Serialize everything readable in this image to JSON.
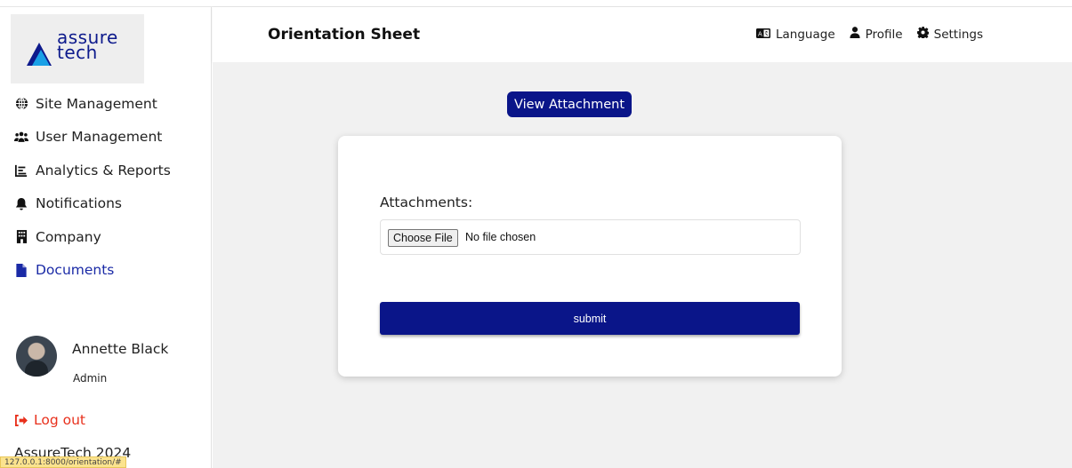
{
  "brand": {
    "line1": "assure",
    "line2": "tech"
  },
  "sidebar": {
    "items": [
      {
        "label": "Site Management",
        "icon": "globe-icon"
      },
      {
        "label": "User Management",
        "icon": "users-icon"
      },
      {
        "label": "Analytics & Reports",
        "icon": "chart-icon"
      },
      {
        "label": "Notifications",
        "icon": "bell-icon"
      },
      {
        "label": "Company",
        "icon": "building-icon"
      },
      {
        "label": "Documents",
        "icon": "document-icon",
        "active": true
      }
    ],
    "user": {
      "name": "Annette Black",
      "role": "Admin"
    },
    "logout_label": "Log out",
    "copyright": "AssureTech 2024"
  },
  "status_bar": {
    "url": "127.0.0.1:8000/orientation/#"
  },
  "header": {
    "title": "Orientation Sheet",
    "actions": [
      {
        "label": "Language",
        "icon": "language-icon"
      },
      {
        "label": "Profile",
        "icon": "user-icon"
      },
      {
        "label": "Settings",
        "icon": "gear-icon"
      }
    ]
  },
  "main": {
    "view_attachment_label": "View Attachment",
    "form": {
      "attachments_label": "Attachments:",
      "choose_file_label": "Choose File",
      "no_file_text": "No file chosen",
      "submit_label": "submit"
    }
  },
  "colors": {
    "primary": "#0a1589",
    "active_nav": "#1a2aa6",
    "logout": "#e8301c",
    "logo_accent": "#1aa0e6"
  }
}
